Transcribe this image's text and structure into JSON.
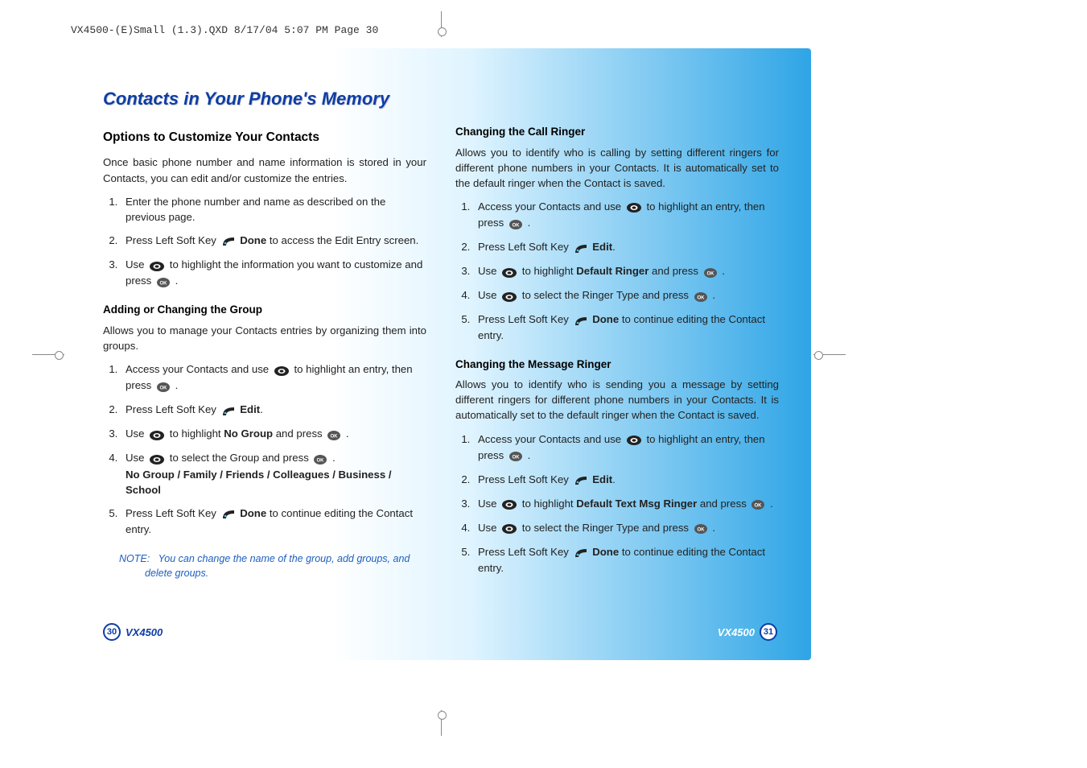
{
  "slug": "VX4500-(E)Small (1.3).QXD  8/17/04  5:07 PM  Page 30",
  "page_title": "Contacts in Your Phone's Memory",
  "model": "VX4500",
  "page_left": "30",
  "page_right": "31",
  "col1": {
    "h2": "Options to Customize Your Contacts",
    "intro": "Once basic phone number and name information is stored in your Contacts, you can edit and/or customize the entries.",
    "steps_a": [
      "Enter the phone number and name as described on the previous page.",
      {
        "pre": "Press Left Soft Key ",
        "icon": "soft",
        "post": " ",
        "bold": "Done",
        "tail": " to access the Edit Entry screen."
      },
      {
        "pre": "Use ",
        "icon": "nav",
        "post": " to highlight the information you want to customize and press ",
        "icon2": "ok",
        "tail": " ."
      }
    ],
    "h3_group": "Adding or Changing the Group",
    "group_intro": "Allows you to manage your Contacts entries by organizing them into groups.",
    "steps_b": [
      {
        "pre": "Access your Contacts and use ",
        "icon": "nav",
        "post": " to highlight an entry, then press ",
        "icon2": "ok",
        "tail": " ."
      },
      {
        "pre": "Press Left Soft Key ",
        "icon": "soft",
        "post": " ",
        "bold": "Edit",
        "tail": "."
      },
      {
        "pre": "Use ",
        "icon": "nav",
        "post": " to highlight ",
        "bold": "No Group",
        "mid": " and press ",
        "icon2": "ok",
        "tail": " ."
      },
      {
        "pre": "Use ",
        "icon": "nav",
        "post": " to select the Group and press ",
        "icon2": "ok",
        "tail": " .",
        "extra_bold": "No Group / Family / Friends / Colleagues / Business / School"
      },
      {
        "pre": "Press Left Soft Key ",
        "icon": "soft",
        "post": " ",
        "bold": "Done",
        "tail": " to continue editing the Contact entry."
      }
    ],
    "note_label": "NOTE:",
    "note_text": "You can change the name of the group, add groups, and delete groups."
  },
  "col2": {
    "h3_call": "Changing the Call Ringer",
    "call_intro": "Allows you to identify who is calling by setting different ringers for different phone numbers in your Contacts. It is automatically set to the default ringer when the Contact is saved.",
    "steps_c": [
      {
        "pre": "Access your Contacts and use ",
        "icon": "nav",
        "post": " to highlight an entry, then press ",
        "icon2": "ok",
        "tail": " ."
      },
      {
        "pre": "Press Left Soft Key ",
        "icon": "soft",
        "post": " ",
        "bold": "Edit",
        "tail": "."
      },
      {
        "pre": "Use ",
        "icon": "nav",
        "post": " to highlight ",
        "bold": "Default Ringer",
        "mid": " and press ",
        "icon2": "ok",
        "tail": " ."
      },
      {
        "pre": "Use ",
        "icon": "nav",
        "post": " to select the Ringer Type and press ",
        "icon2": "ok",
        "tail": " ."
      },
      {
        "pre": "Press Left Soft Key ",
        "icon": "soft",
        "post": " ",
        "bold": "Done",
        "tail": " to continue editing the Contact entry."
      }
    ],
    "h3_msg": "Changing the Message Ringer",
    "msg_intro": "Allows you to identify who is sending you a message by setting different ringers for different phone numbers in your Contacts. It is automatically set to the default ringer when the Contact is saved.",
    "steps_d": [
      {
        "pre": "Access your Contacts and use ",
        "icon": "nav",
        "post": " to highlight an entry, then press ",
        "icon2": "ok",
        "tail": " ."
      },
      {
        "pre": "Press Left Soft Key ",
        "icon": "soft",
        "post": " ",
        "bold": "Edit",
        "tail": "."
      },
      {
        "pre": "Use ",
        "icon": "nav",
        "post": " to highlight ",
        "bold": "Default Text Msg Ringer",
        "mid": " and press ",
        "icon2": "ok",
        "tail": " ."
      },
      {
        "pre": "Use ",
        "icon": "nav",
        "post": " to select the Ringer Type and press ",
        "icon2": "ok",
        "tail": " ."
      },
      {
        "pre": "Press Left Soft Key ",
        "icon": "soft",
        "post": " ",
        "bold": "Done",
        "tail": " to continue editing the Contact entry."
      }
    ]
  }
}
